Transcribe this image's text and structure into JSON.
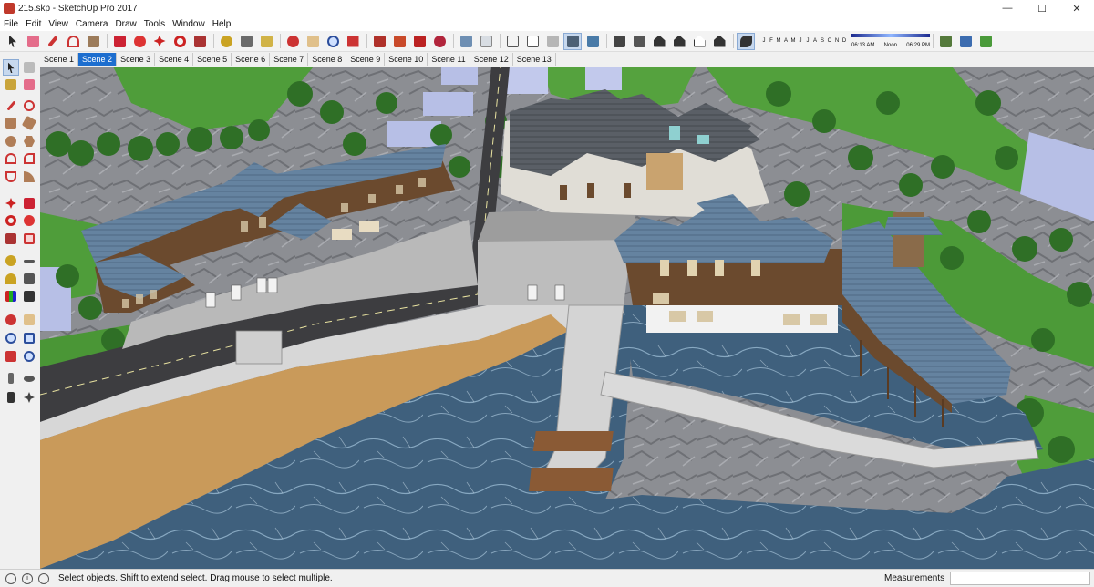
{
  "window": {
    "title": "215.skp - SketchUp Pro 2017",
    "minimize": "—",
    "maximize": "☐",
    "close": "✕"
  },
  "menu": [
    "File",
    "Edit",
    "View",
    "Camera",
    "Draw",
    "Tools",
    "Window",
    "Help"
  ],
  "shadow_settings": {
    "months": [
      "J",
      "F",
      "M",
      "A",
      "M",
      "J",
      "J",
      "A",
      "S",
      "O",
      "N",
      "D"
    ],
    "time_start": "06:13 AM",
    "time_mid": "Noon",
    "time_end": "06:29 PM"
  },
  "scenes": {
    "active_index": 1,
    "tabs": [
      "Scene 1",
      "Scene 2",
      "Scene 3",
      "Scene 4",
      "Scene 5",
      "Scene 6",
      "Scene 7",
      "Scene 8",
      "Scene 9",
      "Scene 10",
      "Scene 11",
      "Scene 12",
      "Scene 13"
    ]
  },
  "status": {
    "message": "Select objects. Shift to extend select. Drag mouse to select multiple.",
    "measurements_label": "Measurements",
    "measurements_value": ""
  },
  "colors": {
    "water": "#3c5c78",
    "sand": "#c99a5a",
    "road": "#3d3d40",
    "grass": "#4f9d3a",
    "rock": "#8a8c90",
    "roof": "#5f7b93",
    "wood": "#7a4e2d",
    "active_tab": "#1d6ecf"
  }
}
